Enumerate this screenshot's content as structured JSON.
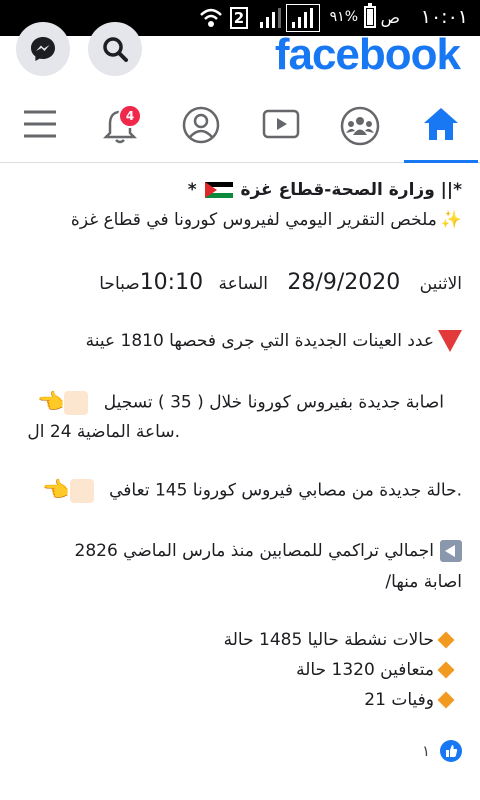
{
  "status_bar": {
    "time": "١٠:٠١",
    "ampm": "ص",
    "battery_pct": "٩١%",
    "sim_label": "2"
  },
  "header": {
    "logo": "facebook",
    "accent": "#1877f2"
  },
  "nav": {
    "notifications_badge": "4"
  },
  "post": {
    "header_line": "*|| وزارة الصحة-قطاع غزة",
    "header_star": "*",
    "summary": "ملخص التقرير اليومي لفيروس كورونا في قطاع غزة",
    "date_prefix": "الاثنين",
    "date": "28/9/2020",
    "time_label": "الساعة",
    "time_value": "10:10",
    "time_suffix": "صباحا",
    "samples": "عدد العينات الجديدة التي جرى فحصها 1810 عينة",
    "new_cases_1": "اصابة جديدة بفيروس كورونا خلال ( 35 ) تسجيل",
    "new_cases_2": ".ساعة الماضية 24 ال",
    "recoveries": ".حالة جديدة من مصابي فيروس كورونا 145 تعافي",
    "cumulative_1": "اجمالي تراكمي للمصابين منذ مارس الماضي 2826",
    "cumulative_2": "اصابة منها/",
    "active": "حالات نشطة حاليا 1485 حالة",
    "recovered": "متعافين 1320 حالة",
    "deaths": "وفيات 21"
  },
  "reactions": {
    "count": "١"
  }
}
